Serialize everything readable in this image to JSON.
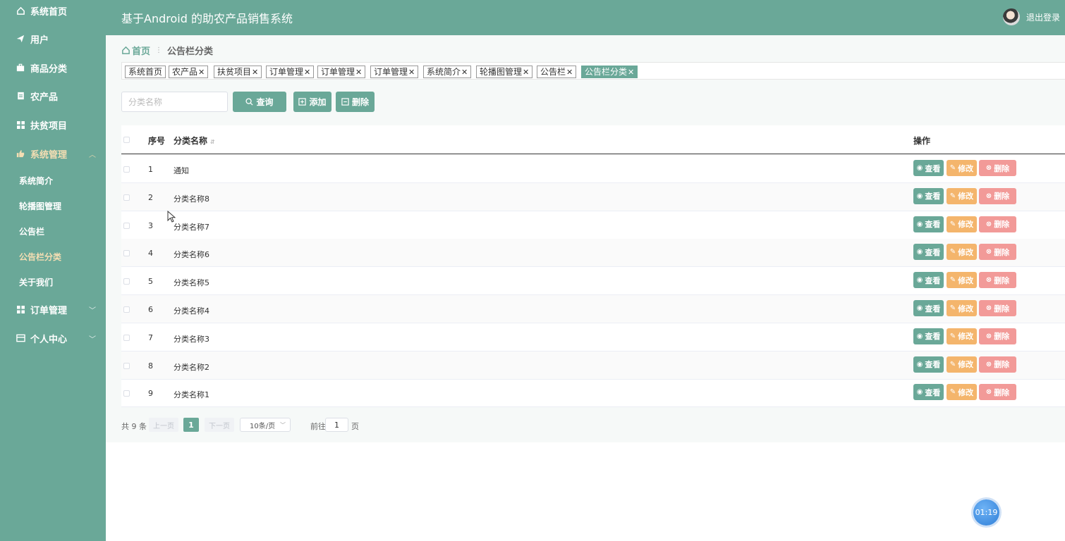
{
  "sidebar": {
    "items": [
      {
        "label": "系统首页",
        "icon": "home-icon"
      },
      {
        "label": "用户",
        "icon": "send-icon"
      },
      {
        "label": "商品分类",
        "icon": "briefcase-icon"
      },
      {
        "label": "农产品",
        "icon": "document-icon"
      },
      {
        "label": "扶贫项目",
        "icon": "grid-icon"
      },
      {
        "label": "系统管理",
        "icon": "thumb-icon",
        "expanded": true
      },
      {
        "label": "订单管理",
        "icon": "grid-icon"
      },
      {
        "label": "个人中心",
        "icon": "card-icon"
      }
    ],
    "subitems": [
      "系统简介",
      "轮播图管理",
      "公告栏",
      "公告栏分类",
      "关于我们"
    ],
    "active_sub": "公告栏分类"
  },
  "header": {
    "title": "基于Android 的助农产品销售系统",
    "logout": "退出登录"
  },
  "breadcrumb": {
    "home": "首页",
    "current": "公告栏分类"
  },
  "tags": [
    "系统首页",
    "农产品",
    "扶贫项目",
    "订单管理",
    "订单管理",
    "订单管理",
    "系统简介",
    "轮播图管理",
    "公告栏",
    "公告栏分类"
  ],
  "search": {
    "placeholder": "分类名称",
    "query_label": "查询",
    "add_label": "添加",
    "delete_label": "删除"
  },
  "table": {
    "columns": {
      "seq": "序号",
      "name": "分类名称",
      "op": "操作"
    },
    "rows": [
      {
        "seq": "1",
        "name": "通知"
      },
      {
        "seq": "2",
        "name": "分类名称8"
      },
      {
        "seq": "3",
        "name": "分类名称7"
      },
      {
        "seq": "4",
        "name": "分类名称6"
      },
      {
        "seq": "5",
        "name": "分类名称5"
      },
      {
        "seq": "6",
        "name": "分类名称4"
      },
      {
        "seq": "7",
        "name": "分类名称3"
      },
      {
        "seq": "8",
        "name": "分类名称2"
      },
      {
        "seq": "9",
        "name": "分类名称1"
      }
    ],
    "actions": {
      "view": "查看",
      "edit": "修改",
      "delete": "删除"
    }
  },
  "pagination": {
    "total": "共 9 条",
    "prev": "上一页",
    "current": "1",
    "next": "下一页",
    "page_size": "10条/页",
    "goto": "前往",
    "goto_value": "1",
    "page_unit": "页"
  },
  "timer": "01:19",
  "colors": {
    "primary": "#6aa898",
    "edit": "#f4b56c",
    "delete": "#f29a98",
    "active_text": "#f5deb3"
  }
}
